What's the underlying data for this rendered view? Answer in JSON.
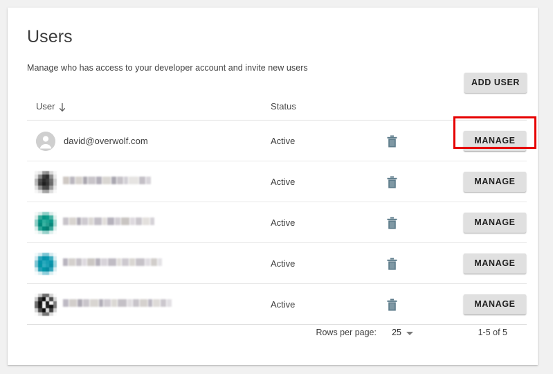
{
  "page": {
    "title": "Users",
    "subtitle": "Manage who has access to your developer account and invite new users",
    "background_color": "#f1f1f1",
    "card_color": "#ffffff"
  },
  "toolbar": {
    "add_user_label": "ADD USER"
  },
  "table": {
    "columns": [
      {
        "key": "user",
        "label": "User",
        "sort_icon": "arrow-down-icon",
        "sorted": "desc"
      },
      {
        "key": "status",
        "label": "Status"
      }
    ],
    "rows": [
      {
        "email": "david@overwolf.com",
        "redacted": false,
        "avatar": {
          "icon": "person-icon",
          "color": "#cfcfcf"
        },
        "status": "Active",
        "delete_icon": "trash-icon",
        "manage_label": "MANAGE",
        "highlighted": true
      },
      {
        "email": "",
        "redacted": true,
        "avatar": {
          "icon": "redacted-avatar",
          "color": "#4a4a4a"
        },
        "status": "Active",
        "delete_icon": "trash-icon",
        "manage_label": "MANAGE",
        "highlighted": false
      },
      {
        "email": "",
        "redacted": true,
        "avatar": {
          "icon": "redacted-avatar",
          "color": "#009688"
        },
        "status": "Active",
        "delete_icon": "trash-icon",
        "manage_label": "MANAGE",
        "highlighted": false
      },
      {
        "email": "",
        "redacted": true,
        "avatar": {
          "icon": "redacted-avatar",
          "color": "#0097a7"
        },
        "status": "Active",
        "delete_icon": "trash-icon",
        "manage_label": "MANAGE",
        "highlighted": false
      },
      {
        "email": "",
        "redacted": true,
        "avatar": {
          "icon": "redacted-avatar",
          "color": "#2b2b2b"
        },
        "status": "Active",
        "delete_icon": "trash-icon",
        "manage_label": "MANAGE",
        "highlighted": false
      }
    ]
  },
  "paginator": {
    "rows_per_page_label": "Rows per page:",
    "rows_per_page_value": "25",
    "range_label": "1-5 of 5"
  },
  "annotation": {
    "highlight_color": "#e60000",
    "target": "manage-button-row-1"
  },
  "colors": {
    "trash_icon": "#5f7d8c",
    "button_face": "#e0e0e0",
    "divider": "#e0e0e0"
  }
}
